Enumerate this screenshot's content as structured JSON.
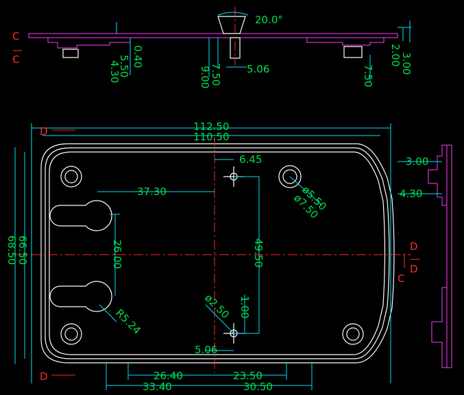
{
  "section_labels": {
    "cc_top": "C",
    "cc_dash": "—",
    "cc_bottom": "C",
    "dd_top": "D",
    "dd_dash": "—",
    "dd_bottom": "D",
    "d_top_left": "D",
    "d_bottom_left": "D",
    "c_right": "C"
  },
  "dimensions": {
    "angle": "20.0°",
    "d_0_40": "0.40",
    "d_5_50": "5.50",
    "d_4_30_top": "4.30",
    "d_9_00": "9.00",
    "d_7_50_a": "7.50",
    "d_5_06_top": "5.06",
    "d_7_50_b": "7.50",
    "d_2_00": "2.00",
    "d_3_00_top": "3.00",
    "d_112_50": "112.50",
    "d_110_50": "110.50",
    "d_6_45": "6.45",
    "d_37_30": "37.30",
    "d_phi_5_50": "ø5.50",
    "d_phi_7_50": "ø7.50",
    "d_66_50": "66.50",
    "d_68_50": "68.50",
    "d_26_00": "26.00",
    "d_49_50": "49.50",
    "d_1_00": "1.00",
    "d_phi_2_50": "ø2.50",
    "d_r5_24": "R5.24",
    "d_5_06_bottom": "5.06",
    "d_26_40": "26.40",
    "d_23_50": "23.50",
    "d_33_40": "33.40",
    "d_30_50": "30.50",
    "d_3_00_side": "3.00",
    "d_4_30_side": "4.30"
  },
  "colors": {
    "background": "#000000",
    "dimension_text": "#00e04a",
    "section_label": "#ff2a2a",
    "outline": "#ffffff",
    "dimension_line": "#00e0ff",
    "center_line": "#ff2a2a",
    "section_hatch": "#ff3cff"
  }
}
